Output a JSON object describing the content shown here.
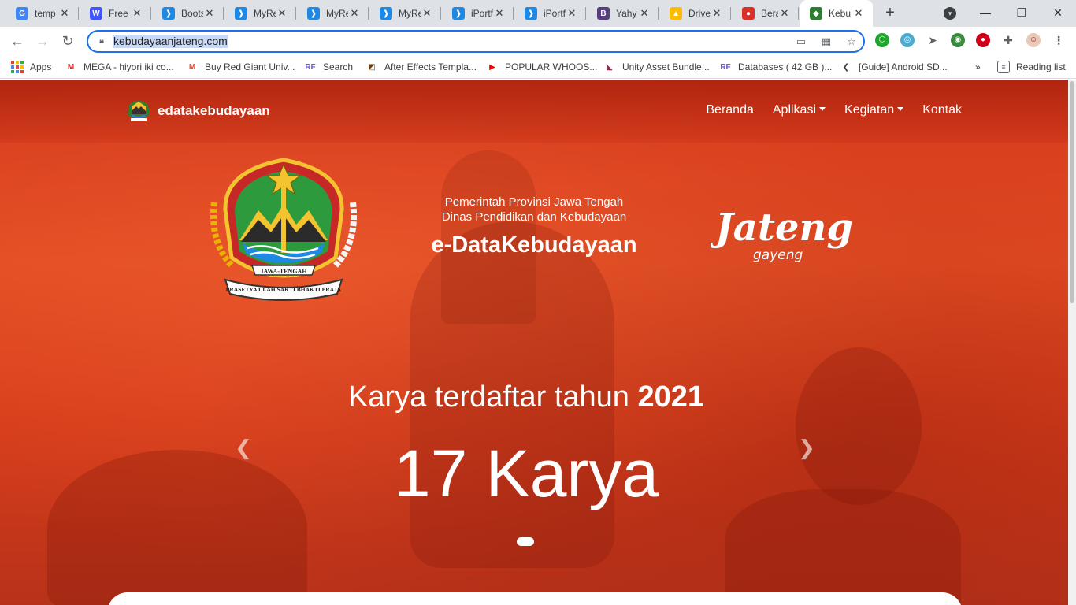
{
  "browser": {
    "tabs": [
      {
        "title": "temp",
        "icon": "google-icon",
        "color": "#4285f4",
        "glyph": "G"
      },
      {
        "title": "Free",
        "icon": "webflow-w-icon",
        "color": "#4353ff",
        "glyph": "W"
      },
      {
        "title": "Boots",
        "icon": "bootstrapmade-icon",
        "color": "#1e88e5",
        "glyph": "❱"
      },
      {
        "title": "MyRe",
        "icon": "bootstrapmade-icon",
        "color": "#1e88e5",
        "glyph": "❱"
      },
      {
        "title": "MyRe",
        "icon": "bootstrapmade-icon",
        "color": "#1e88e5",
        "glyph": "❱"
      },
      {
        "title": "MyRe",
        "icon": "bootstrapmade-icon",
        "color": "#1e88e5",
        "glyph": "❱"
      },
      {
        "title": "iPortf",
        "icon": "bootstrapmade-icon",
        "color": "#1e88e5",
        "glyph": "❱"
      },
      {
        "title": "iPortf",
        "icon": "bootstrapmade-icon",
        "color": "#1e88e5",
        "glyph": "❱"
      },
      {
        "title": "Yahy",
        "icon": "bootstrap-b-icon",
        "color": "#563d7c",
        "glyph": "B"
      },
      {
        "title": "Drive",
        "icon": "google-drive-icon",
        "color": "#fbbc04",
        "glyph": "▲"
      },
      {
        "title": "Berar",
        "icon": "red-emblem-icon",
        "color": "#d93025",
        "glyph": "●"
      },
      {
        "title": "Kebu",
        "icon": "jateng-emblem-icon",
        "color": "#2e7d32",
        "glyph": "◆"
      }
    ],
    "active_tab_index": 11,
    "url": "kebudayaanjateng.com",
    "bookmarks": [
      {
        "label": "Apps",
        "icon": "apps-grid-icon"
      },
      {
        "label": "MEGA - hiyori iki co...",
        "icon": "mega-icon",
        "color": "#d9272e",
        "glyph": "M"
      },
      {
        "label": "Buy Red Giant Univ...",
        "icon": "gmail-icon",
        "color": "#ea4335",
        "glyph": "M"
      },
      {
        "label": "Search",
        "icon": "rf-icon",
        "color": "#6a5acd",
        "glyph": "RF"
      },
      {
        "label": "After Effects Templa...",
        "icon": "ae-template-icon",
        "color": "#6b3e12",
        "glyph": "◩"
      },
      {
        "label": "POPULAR WHOOS...",
        "icon": "youtube-icon",
        "color": "#ff0000",
        "glyph": "▶"
      },
      {
        "label": "Unity Asset Bundle...",
        "icon": "unity-icon",
        "color": "#8c2a4e",
        "glyph": "◣"
      },
      {
        "label": "Databases ( 42 GB )...",
        "icon": "rf-icon",
        "color": "#6a5acd",
        "glyph": "RF"
      },
      {
        "label": "[Guide] Android SD...",
        "icon": "xda-icon",
        "color": "#3c4043",
        "glyph": "❮"
      }
    ],
    "more_bookmarks": "»",
    "reading_list": "Reading list"
  },
  "site": {
    "brand": "edatakebudayaan",
    "menu": [
      {
        "label": "Beranda",
        "dropdown": false
      },
      {
        "label": "Aplikasi",
        "dropdown": true
      },
      {
        "label": "Kegiatan",
        "dropdown": true
      },
      {
        "label": "Kontak",
        "dropdown": false
      }
    ],
    "header": {
      "line1": "Pemerintah Provinsi Jawa Tengah",
      "line2": "Dinas Pendidikan dan Kebudayaan",
      "title": "e-DataKebudayaan"
    },
    "emblem": {
      "ribbon": "JAWA-TENGAH",
      "motto": "PRASETYA ULAH SAKTI BHAKTI PRAJA"
    },
    "jateng_logo": {
      "word": "Jateng",
      "sub": "gayeng"
    },
    "slide": {
      "heading_prefix": "Karya terdaftar tahun",
      "year": "2021",
      "count": "17 Karya"
    },
    "colors": {
      "hero": "#e24b22",
      "hero_dark": "#b8321a",
      "accent_link": "#1a73e8"
    }
  }
}
